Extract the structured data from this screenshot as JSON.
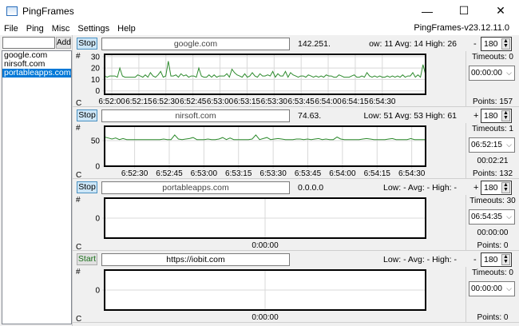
{
  "window": {
    "title": "PingFrames",
    "minimize": "—",
    "maximize": "☐",
    "close": "✕"
  },
  "menu": {
    "items": [
      "File",
      "Ping",
      "Misc",
      "Settings",
      "Help"
    ],
    "version": "PingFrames-v23.12.11.0"
  },
  "sidebar": {
    "add_input": "",
    "add_label": "Add",
    "hosts": [
      "google.com",
      "nirsoft.com",
      "portableapps.com"
    ],
    "selected": 2
  },
  "colors": {
    "line": "#2e8b2e",
    "accent": "#0078d7"
  },
  "panels": [
    {
      "button": "Stop",
      "host": "google.com",
      "ip": "142.251.",
      "stats": "ow: 11  Avg: 14  High: 26",
      "sign": "-",
      "count": "180",
      "hash": "#",
      "c": "C",
      "timeouts": "Timeouts: 0",
      "combo": "00:00:00",
      "elapsed": "",
      "points": "Points: 157"
    },
    {
      "button": "Stop",
      "host": "nirsoft.com",
      "ip": "74.63.",
      "stats": "Low: 51  Avg: 53  High: 61",
      "sign": "+",
      "count": "180",
      "hash": "#",
      "c": "C",
      "timeouts": "Timeouts: 1",
      "combo": "06:52:15",
      "elapsed": "00:02:21",
      "points": "Points: 132"
    },
    {
      "button": "Stop",
      "host": "portableapps.com",
      "ip": "0.0.0.0",
      "stats": "Low: -  Avg: -  High: -",
      "sign": "+",
      "count": "180",
      "hash": "#",
      "c": "C",
      "timeouts": "Timeouts: 30",
      "combo": "06:54:35",
      "elapsed": "00:00:00",
      "points": "Points: 0"
    },
    {
      "button": "Start",
      "host": "https://iobit.com",
      "ip": "",
      "stats": "Low: -  Avg: -  High: -",
      "sign": "-",
      "count": "180",
      "hash": "#",
      "c": "C",
      "timeouts": "Timeouts: 0",
      "combo": "00:00:00",
      "elapsed": "",
      "points": "Points: 0"
    }
  ],
  "chart_data": [
    {
      "type": "line",
      "ylim": [
        -3,
        32
      ],
      "yticks": [
        "0",
        "10",
        "20",
        "30"
      ],
      "ytick_values": [
        0,
        10,
        20,
        30
      ],
      "xlim_seconds": [
        0,
        178
      ],
      "xticks": [
        "6:52:00",
        "6:52:15",
        "6:52:30",
        "6:52:45",
        "6:53:00",
        "6:53:15",
        "6:53:30",
        "6:53:45",
        "6:54:00",
        "6:54:15",
        "6:54:30"
      ],
      "xtick_seconds": [
        4,
        19,
        34,
        49,
        64,
        79,
        94,
        109,
        124,
        139,
        154
      ],
      "values": [
        13,
        12,
        13,
        13,
        13,
        12,
        20,
        13,
        12,
        12,
        12,
        12,
        12,
        14,
        13,
        12,
        14,
        12,
        16,
        13,
        12,
        14,
        17,
        12,
        13,
        26,
        13,
        13,
        14,
        12,
        15,
        13,
        14,
        12,
        13,
        13,
        12,
        20,
        13,
        12,
        12,
        14,
        12,
        14,
        12,
        13,
        13,
        13,
        15,
        12,
        19,
        16,
        14,
        13,
        12,
        15,
        12,
        13,
        16,
        13,
        12,
        15,
        13,
        13,
        14,
        13,
        17,
        12,
        15,
        13,
        13,
        17,
        12,
        16,
        14,
        13,
        12,
        13,
        13,
        12,
        14,
        13,
        12,
        13,
        12,
        13,
        12,
        14,
        13,
        13,
        12,
        12,
        14,
        13,
        12,
        12,
        12,
        13,
        14,
        12,
        12,
        13,
        12,
        16,
        13,
        12,
        13,
        12,
        13,
        12,
        12,
        13,
        12,
        13,
        12,
        13,
        12,
        14,
        12,
        13,
        13,
        16,
        12,
        14,
        12,
        23,
        14
      ]
    },
    {
      "type": "line",
      "ylim": [
        0,
        78
      ],
      "yticks": [
        "0",
        "50"
      ],
      "ytick_values": [
        0,
        50
      ],
      "xlim_seconds": [
        0,
        139
      ],
      "xticks": [
        "6:52:30",
        "6:52:45",
        "6:53:00",
        "6:53:15",
        "6:53:30",
        "6:53:45",
        "6:54:00",
        "6:54:15",
        "6:54:30"
      ],
      "xtick_seconds": [
        13,
        28,
        43,
        58,
        73,
        88,
        103,
        118,
        133
      ],
      "values": [
        57,
        55,
        53,
        55,
        52,
        54,
        52,
        52,
        52,
        52,
        52,
        52,
        52,
        52,
        52,
        52,
        53,
        52,
        52,
        61,
        53,
        52,
        53,
        54,
        56,
        52,
        52,
        52,
        53,
        52,
        52,
        53,
        56,
        52,
        55,
        52,
        52,
        52,
        52,
        52,
        53,
        61,
        52,
        54,
        56,
        52,
        53,
        54,
        53,
        52,
        52,
        52,
        53,
        53,
        52,
        53,
        52,
        53,
        54,
        52,
        53,
        52,
        52,
        57,
        53,
        52,
        52,
        52,
        52,
        52,
        53,
        54,
        53,
        52,
        52,
        52,
        52,
        53,
        54,
        52,
        52,
        52,
        52,
        54,
        52,
        52,
        52,
        52
      ]
    },
    {
      "type": "line",
      "ylim": [
        -1,
        1
      ],
      "yticks": [
        "0"
      ],
      "ytick_values": [
        0
      ],
      "xlim_seconds": [
        -1,
        1
      ],
      "xticks": [
        "0:00:00"
      ],
      "xtick_seconds": [
        0
      ],
      "values": []
    },
    {
      "type": "line",
      "ylim": [
        -1,
        1
      ],
      "yticks": [
        "0"
      ],
      "ytick_values": [
        0
      ],
      "xlim_seconds": [
        -1,
        1
      ],
      "xticks": [
        "0:00:00"
      ],
      "xtick_seconds": [
        0
      ],
      "values": []
    }
  ]
}
